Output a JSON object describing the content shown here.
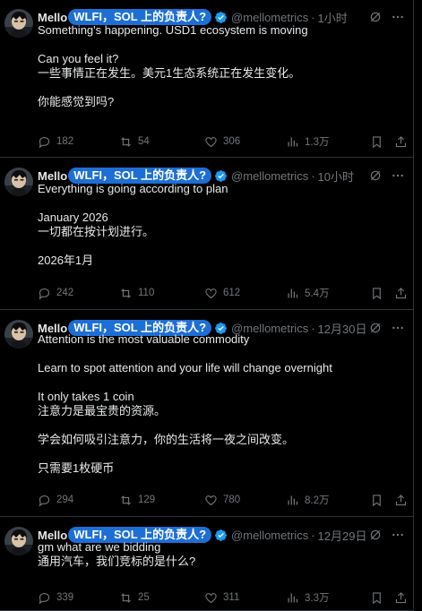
{
  "tweets": [
    {
      "name": "Mello",
      "label": "WLFI，SOL 上的负责人?",
      "handle": "@mellometrics",
      "sep": "·",
      "time": "1小时",
      "lines": [
        "Something's happening. USD1 ecosystem is moving",
        "",
        "Can you feel it?",
        "一些事情正在发生。美元1生态系统正在发生变化。",
        "",
        "你能感觉到吗?"
      ],
      "replies": "182",
      "retweets": "54",
      "likes": "306",
      "views": "1.3万"
    },
    {
      "name": "Mello",
      "label": "WLFI，SOL 上的负责人?",
      "handle": "@mellometrics",
      "sep": "·",
      "time": "10小时",
      "lines": [
        "Everything is going according to plan",
        "",
        "January 2026",
        "一切都在按计划进行。",
        "",
        "2026年1月"
      ],
      "replies": "242",
      "retweets": "110",
      "likes": "612",
      "views": "5.4万"
    },
    {
      "name": "Mello",
      "label": "WLFI，SOL 上的负责人?",
      "handle": "@mellometrics",
      "sep": "·",
      "time": "12月30日",
      "lines": [
        "Attention is the most valuable commodity",
        "",
        "Learn to spot attention and your life will change overnight",
        "",
        "It only takes 1 coin",
        "注意力是最宝贵的资源。",
        "",
        "学会如何吸引注意力，你的生活将一夜之间改变。",
        "",
        "只需要1枚硬币"
      ],
      "replies": "294",
      "retweets": "129",
      "likes": "780",
      "views": "8.2万"
    },
    {
      "name": "Mello",
      "label": "WLFI，SOL 上的负责人?",
      "handle": "@mellometrics",
      "sep": "·",
      "time": "12月29日",
      "lines": [
        "gm what are we bidding",
        "通用汽车，我们竞标的是什么?"
      ],
      "replies": "339",
      "retweets": "25",
      "likes": "311",
      "views": "3.3万"
    }
  ],
  "colors": {
    "background": "#000000",
    "text": "#e7e9ea",
    "muted": "#71767b",
    "badge": "#1d6fd6",
    "verified": "#1d9bf0"
  }
}
